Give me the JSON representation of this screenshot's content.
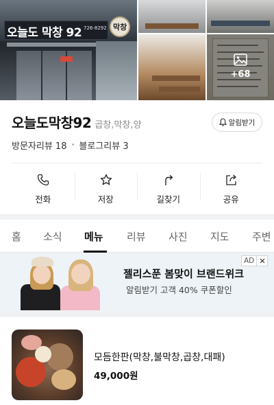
{
  "gallery": {
    "storefront_sign": "오늘도 막창 92",
    "storefront_phone": "726-8292",
    "storefront_round_sign": "막창",
    "more_photos": "+68"
  },
  "place": {
    "name": "오늘도막창92",
    "category": "곱창,막창,양",
    "notify_label": "알림받기",
    "visitor_reviews": "방문자리뷰 18",
    "blog_reviews": "블로그리뷰 3"
  },
  "actions": [
    {
      "label": "전화",
      "icon": "phone-icon"
    },
    {
      "label": "저장",
      "icon": "star-icon"
    },
    {
      "label": "길찾기",
      "icon": "directions-icon"
    },
    {
      "label": "공유",
      "icon": "share-icon"
    }
  ],
  "tabs": [
    "홈",
    "소식",
    "메뉴",
    "리뷰",
    "사진",
    "지도",
    "주변"
  ],
  "active_tab": "메뉴",
  "ad": {
    "badge": "AD",
    "title": "젤리스푼 봄맞이 브랜드위크",
    "subtitle": "알림받기 고객 40% 쿠폰할인"
  },
  "menu_items": [
    {
      "name": "모듬한판(막창,불막창,곱창,대패)",
      "price": "49,000원"
    }
  ],
  "colors": {
    "accent": "#111111",
    "ad_background": "#edf3f7",
    "divider": "#f0f1f3"
  }
}
